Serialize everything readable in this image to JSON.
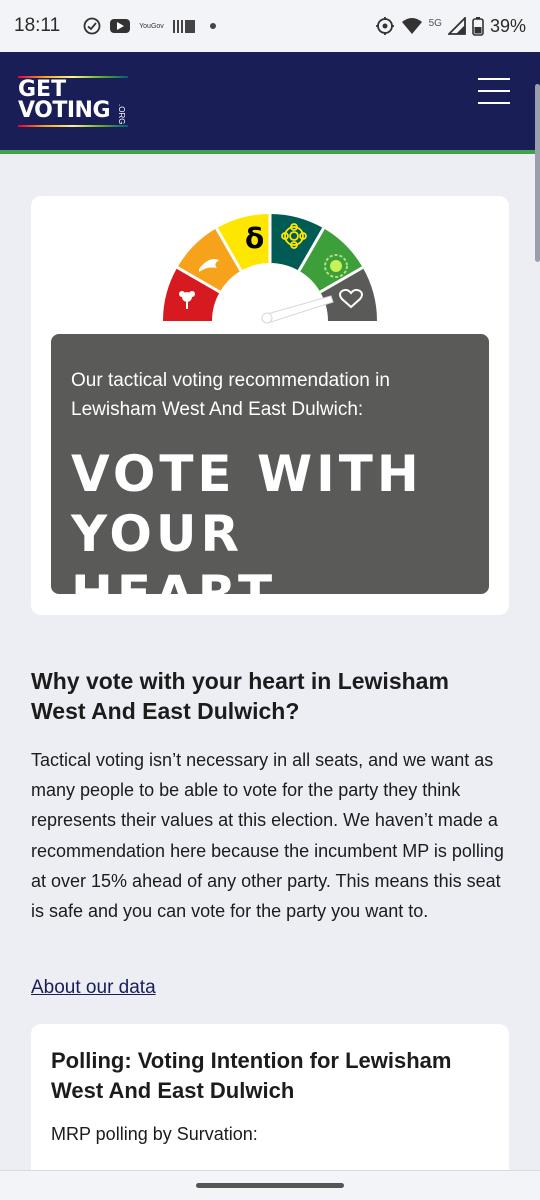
{
  "status_bar": {
    "time": "18:11",
    "yougov": "YouGov",
    "network": "5G",
    "battery": "39%",
    "icons": [
      "check-circle-icon",
      "youtube-icon",
      "barcode-icon",
      "dot-icon",
      "location-icon",
      "wifi-icon",
      "signal-icon",
      "battery-icon"
    ]
  },
  "header": {
    "logo_top": "GET",
    "logo_bottom": "VOTING",
    "logo_suffix": ".ORG",
    "menu_icon": "hamburger-menu-icon",
    "bg_color": "#1a1e57",
    "accent_color": "#3ea34a"
  },
  "gauge": {
    "segments": [
      {
        "party": "Labour",
        "icon": "labour-rose-icon",
        "color": "#d71920"
      },
      {
        "party": "Liberal Democrats",
        "icon": "libdem-bird-icon",
        "color": "#f7a21b"
      },
      {
        "party": "SNP",
        "icon": "snp-symbol-icon",
        "color": "#ffe600"
      },
      {
        "party": "Plaid Cymru",
        "icon": "plaid-flower-icon",
        "color": "#005b54"
      },
      {
        "party": "Green",
        "icon": "green-globe-icon",
        "color": "#3d9f3a"
      },
      {
        "party": "Heart",
        "icon": "heart-icon",
        "color": "#5a5a58"
      }
    ],
    "pointer_segment": "Heart"
  },
  "recommendation": {
    "intro": "Our tactical voting recommendation in Lewisham West And East Dulwich:",
    "verdict": "VOTE WITH YOUR HEART",
    "box_color": "#5a5a58"
  },
  "why": {
    "heading": "Why vote with your heart in Lewisham West And East Dulwich?",
    "body": "Tactical voting isn’t necessary in all seats, and we want as many people to be able to vote for the party they think represents their values at this election. We haven’t made a recommendation here because the incumbent MP is polling at over 15% ahead of any other party. This means this seat is safe and you can vote for the party you want to.",
    "link": "About our data"
  },
  "polling": {
    "title": "Polling: Voting Intention for Lewisham West And East Dulwich",
    "subtitle": "MRP polling by Survation:"
  }
}
